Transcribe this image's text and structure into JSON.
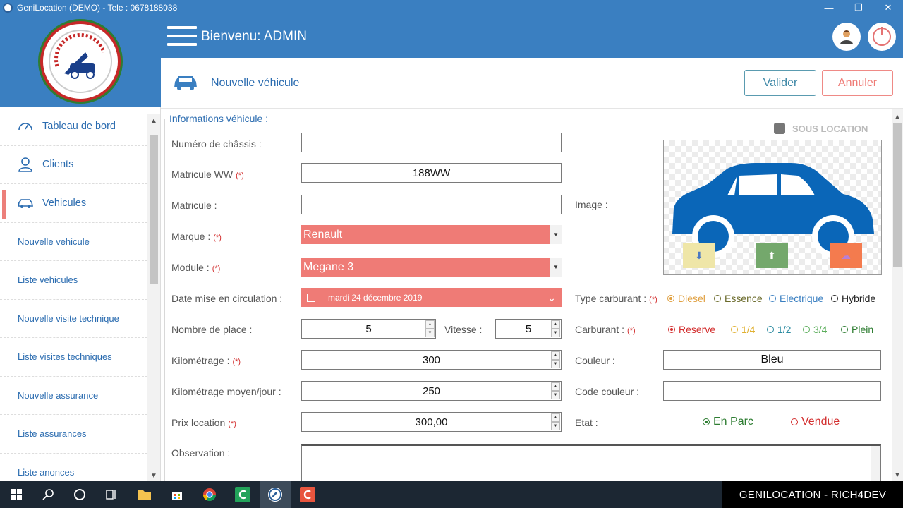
{
  "window": {
    "title": "GeniLocation (DEMO) - Tele : 0678188038",
    "controls": [
      "—",
      "❐",
      "✕"
    ]
  },
  "header": {
    "welcome": "Bienvenu: ADMIN"
  },
  "sidebar": {
    "items": [
      {
        "label": "Tableau de bord",
        "icon": "dashboard-icon"
      },
      {
        "label": "Clients",
        "icon": "user-icon"
      },
      {
        "label": "Vehicules",
        "icon": "car-icon"
      }
    ],
    "sub_items": [
      "Nouvelle vehicule",
      "Liste vehicules",
      "Nouvelle visite technique",
      "Liste visites techniques",
      "Nouvelle assurance",
      "Liste assurances",
      "Liste anonces"
    ]
  },
  "page": {
    "title": "Nouvelle véhicule",
    "valider": "Valider",
    "annuler": "Annuler"
  },
  "form": {
    "group_title": "Informations véhicule :",
    "sous_location": "SOUS LOCATION",
    "req": "(*)",
    "chassis": {
      "label": "Numéro de châssis :",
      "value": ""
    },
    "matricule_ww": {
      "label": "Matricule WW",
      "value": "188WW"
    },
    "matricule": {
      "label": "Matricule :",
      "value": ""
    },
    "marque": {
      "label": "Marque :",
      "value": "Renault"
    },
    "module": {
      "label": "Module :",
      "value": "Megane 3"
    },
    "date_circulation": {
      "label": "Date mise en circulation :",
      "value": "mardi 24 décembre 2019"
    },
    "nombre_place": {
      "label": "Nombre de place :",
      "value": "5"
    },
    "vitesse": {
      "label": "Vitesse :",
      "value": "5"
    },
    "kilometrage": {
      "label": "Kilométrage :",
      "value": "300"
    },
    "km_moyen": {
      "label": "Kilométrage moyen/jour :",
      "value": "250"
    },
    "prix_location": {
      "label": "Prix location",
      "value": "300,00"
    },
    "observation": {
      "label": "Observation :",
      "value": ""
    },
    "image": {
      "label": "Image :"
    },
    "type_carburant": {
      "label": "Type carburant :",
      "options": [
        "Diesel",
        "Essence",
        "Electrique",
        "Hybride"
      ],
      "selected": "Diesel"
    },
    "carburant": {
      "label": "Carburant :",
      "options": [
        "Reserve",
        "1/4",
        "1/2",
        "3/4",
        "Plein"
      ],
      "selected": "Reserve"
    },
    "couleur": {
      "label": "Couleur :",
      "value": "Bleu"
    },
    "code_couleur": {
      "label": "Code couleur :",
      "value": ""
    },
    "etat": {
      "label": "Etat :",
      "options": [
        "En Parc",
        "Vendue"
      ],
      "selected": "En Parc"
    }
  },
  "taskbar": {
    "brand": "GENILOCATION - RICH4DEV"
  },
  "colors": {
    "primary": "#3a7fc1",
    "accent_red": "#ef7b76",
    "car_blue": "#0a66b8"
  }
}
